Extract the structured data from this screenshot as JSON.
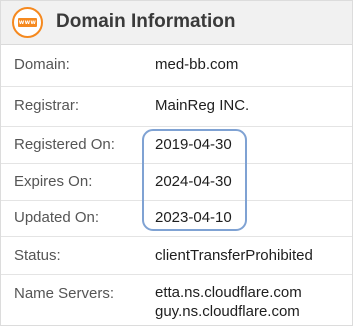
{
  "header": {
    "icon_text": "www",
    "icon": "www-globe-icon",
    "title": "Domain Information"
  },
  "rows": [
    {
      "label": "Domain:",
      "value": "med-bb.com"
    },
    {
      "label": "Registrar:",
      "value": "MainReg INC."
    },
    {
      "label": "Registered On:",
      "value": "2019-04-30"
    },
    {
      "label": "Expires On:",
      "value": "2024-04-30"
    },
    {
      "label": "Updated On:",
      "value": "2023-04-10"
    },
    {
      "label": "Status:",
      "value": "clientTransferProhibited"
    },
    {
      "label": "Name Servers:",
      "values": [
        "etta.ns.cloudflare.com",
        "guy.ns.cloudflare.com"
      ]
    }
  ],
  "highlight_color": "#7fa2d3",
  "accent_color": "#f5891f"
}
